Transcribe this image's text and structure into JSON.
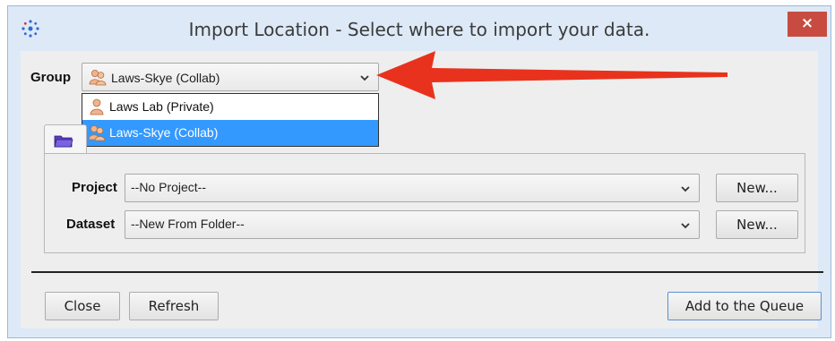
{
  "window": {
    "title": "Import Location - Select where to import your data.",
    "close_glyph": "×",
    "app_icon": "omero-logo-icon"
  },
  "group": {
    "label": "Group",
    "selected": "Laws-Skye (Collab)",
    "options": [
      {
        "label": "Laws Lab (Private)",
        "icon": "single-user-icon"
      },
      {
        "label": "Laws-Skye (Collab)",
        "icon": "group-users-icon",
        "selected": true
      }
    ]
  },
  "tabs": [
    {
      "icon": "folder-icon"
    }
  ],
  "form": {
    "project_label": "Project",
    "project_value": "--No Project--",
    "project_new": "New...",
    "dataset_label": "Dataset",
    "dataset_value": "--New From Folder--",
    "dataset_new": "New..."
  },
  "footer": {
    "close": "Close",
    "refresh": "Refresh",
    "add_to_queue": "Add to the Queue"
  },
  "colors": {
    "title_bg": "#dde9f7",
    "close_button": "#c84b41",
    "selection": "#3399ff",
    "annotation_arrow": "#e8321d"
  }
}
